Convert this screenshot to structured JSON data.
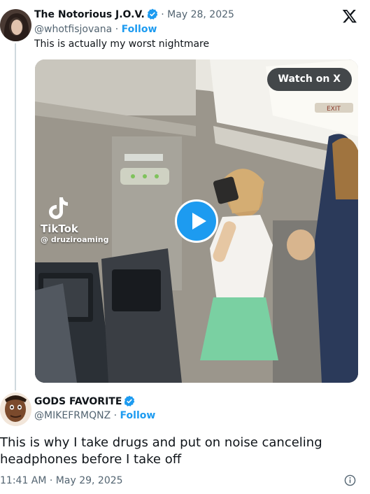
{
  "quoted_tweet": {
    "display_name": "The Notorious J.O.V.",
    "handle": "@whotfisjovana",
    "date": "· May 28, 2025",
    "follow": "Follow",
    "text": "This is actually my worst nightmare",
    "media": {
      "watch_label": "Watch on X",
      "watermark_brand": "TikTok",
      "watermark_handle": "@ druziroaming",
      "sign_text": "EXIT"
    }
  },
  "reply_tweet": {
    "display_name": "GODS FAVORITE",
    "handle": "@MIKEFRMQNZ",
    "follow": "Follow",
    "text": "This is why I take drugs and put on noise canceling headphones before I take off",
    "timestamp": "11:41 AM · May 29, 2025"
  },
  "colors": {
    "accent": "#1d9bf0",
    "muted": "#536471",
    "text": "#0f1419"
  },
  "icons": [
    "x-logo-icon",
    "verified-badge-icon",
    "play-icon",
    "tiktok-logo-icon",
    "info-icon"
  ]
}
